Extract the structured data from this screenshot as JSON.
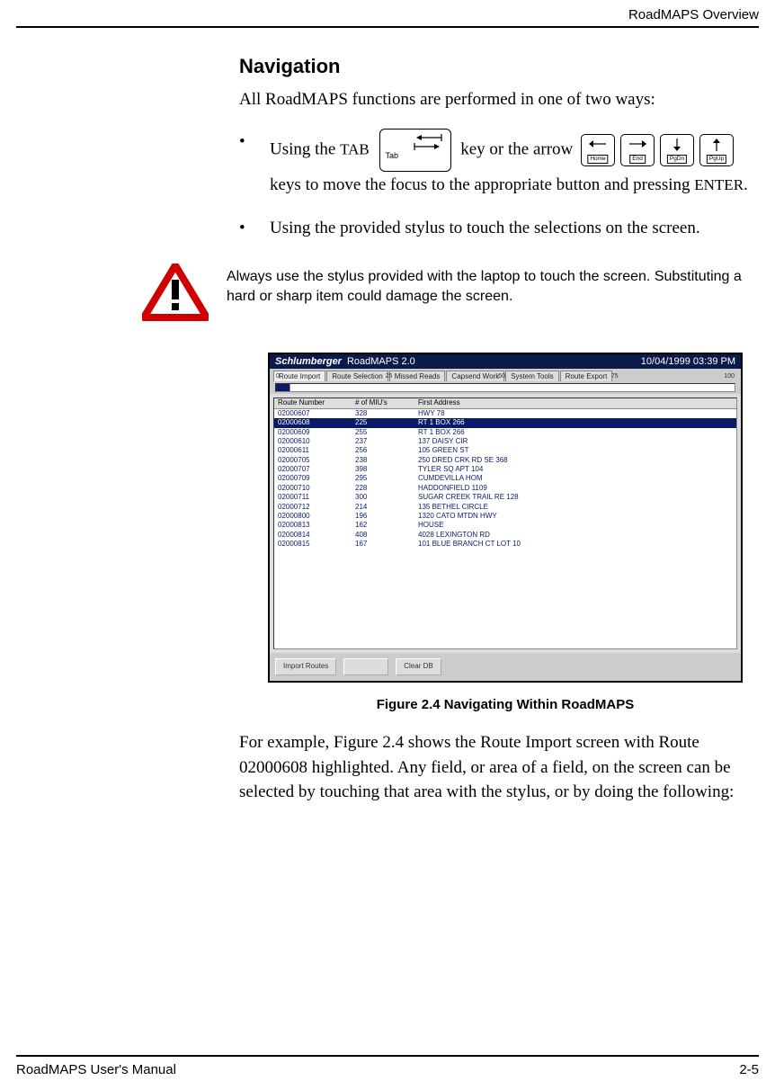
{
  "header": {
    "chapter_title": "RoadMAPS Overview"
  },
  "section": {
    "title": "Navigation"
  },
  "intro": "All RoadMAPS functions are performed in one of two ways:",
  "bullets": {
    "b1_pre": "Using the ",
    "b1_tab_word": "TAB",
    "b1_tablabel": "Tab",
    "b1_mid": " key or the arrow ",
    "b1_post": "keys to move the focus to the appropriate button and pressing ",
    "b1_enter": "ENTER",
    "b1_dot": ".",
    "b2": "Using the provided stylus to touch the selections on the screen."
  },
  "arrow_keys": {
    "k1": "Home",
    "k2": "End",
    "k3": "PgDn",
    "k4": "PgUp"
  },
  "warning": "Always use the stylus provided with the laptop to touch the screen. Substituting a hard or sharp item could damage the screen.",
  "app": {
    "brand": "Schlumberger",
    "title": "RoadMAPS 2.0",
    "datetime": "10/04/1999 03:39 PM",
    "tabs": [
      "Route Import",
      "Route Selection",
      "Missed Reads",
      "Capsend Work",
      "System Tools",
      "Route Export"
    ],
    "ticks": [
      "0",
      "25",
      "50",
      "75",
      "100"
    ],
    "columns": [
      "Route Number",
      "# of MIU's",
      "First Address"
    ],
    "rows": [
      {
        "r": "02000607",
        "m": "328",
        "a": "HWY 78"
      },
      {
        "r": "02000608",
        "m": "225",
        "a": "RT 1 BOX 266",
        "sel": true
      },
      {
        "r": "02000609",
        "m": "255",
        "a": "RT 1 BOX 266"
      },
      {
        "r": "02000610",
        "m": "237",
        "a": "137 DAISY CIR"
      },
      {
        "r": "02000611",
        "m": "256",
        "a": "105 GREEN ST"
      },
      {
        "r": "02000705",
        "m": "238",
        "a": "250 DRED CRK RD SE 368"
      },
      {
        "r": "02000707",
        "m": "398",
        "a": "TYLER SQ APT 104"
      },
      {
        "r": "02000709",
        "m": "295",
        "a": "CUMDEVILLA HOM"
      },
      {
        "r": "02000710",
        "m": "228",
        "a": "HADDONFIELD 1109"
      },
      {
        "r": "02000711",
        "m": "300",
        "a": "SUGAR CREEK TRAIL RE 128"
      },
      {
        "r": "02000712",
        "m": "214",
        "a": "135 BETHEL CIRCLE"
      },
      {
        "r": "02000800",
        "m": "196",
        "a": "1320 CATO MTDN HWY"
      },
      {
        "r": "02000813",
        "m": "162",
        "a": "HOUSE"
      },
      {
        "r": "02000814",
        "m": "408",
        "a": "4028 LEXINGTON RD"
      },
      {
        "r": "02000815",
        "m": "167",
        "a": "101 BLUE BRANCH CT LOT 10"
      }
    ],
    "buttons": {
      "import": "Import Routes",
      "mid": "",
      "clear": "Clear DB"
    }
  },
  "figure": {
    "caption": "Figure 2.4   Navigating Within RoadMAPS"
  },
  "example_para": "For example, Figure 2.4 shows the Route Import screen with Route 02000608 highlighted. Any field, or area of a field, on the screen can be selected by touching that area with the stylus, or by doing the following:",
  "footer": {
    "manual": "RoadMAPS User's Manual",
    "page": "2-5"
  }
}
